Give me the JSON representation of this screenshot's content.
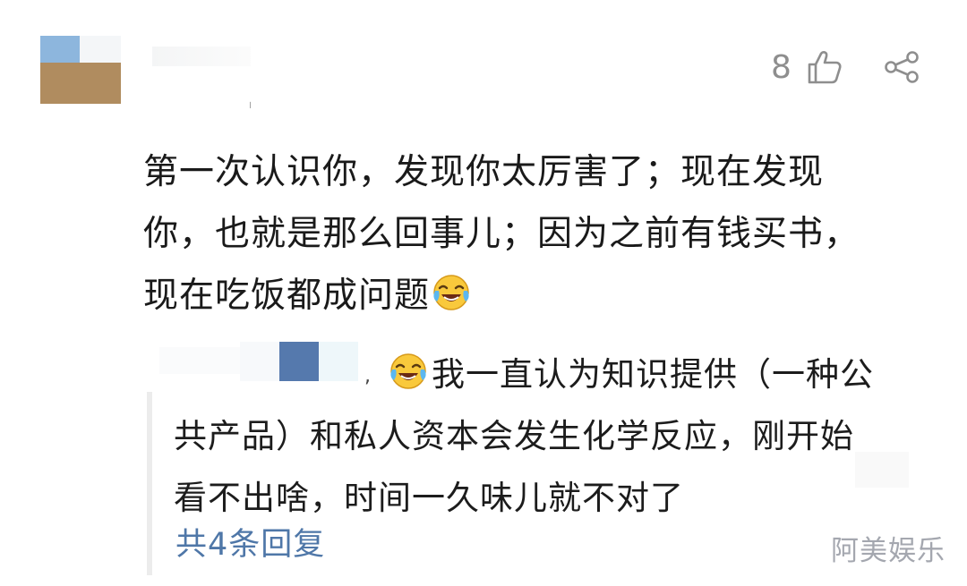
{
  "header": {
    "like_count": "8",
    "like_icon": "thumbs-up-icon",
    "share_icon": "share-icon"
  },
  "comment": {
    "lines": [
      "第一次认识你，发现你太厉害了；现在发现",
      "你，也就是那么回事儿；因为之前有钱买书，",
      "现在吃饭都成问题"
    ],
    "emoji": "laughing-crying-emoji"
  },
  "reply": {
    "emoji": "laughing-crying-emoji",
    "lines": [
      "我一直认为知识提供（一种公",
      "共产品）和私人资本会发生化学反应，刚开始",
      "看不出啥，时间一久味儿就不对了"
    ],
    "count_label": "共4条回复"
  },
  "watermark": "阿美娱乐",
  "colors": {
    "link": "#4f77a8",
    "muted": "#8e8e8e",
    "text": "#1c1c1c"
  }
}
